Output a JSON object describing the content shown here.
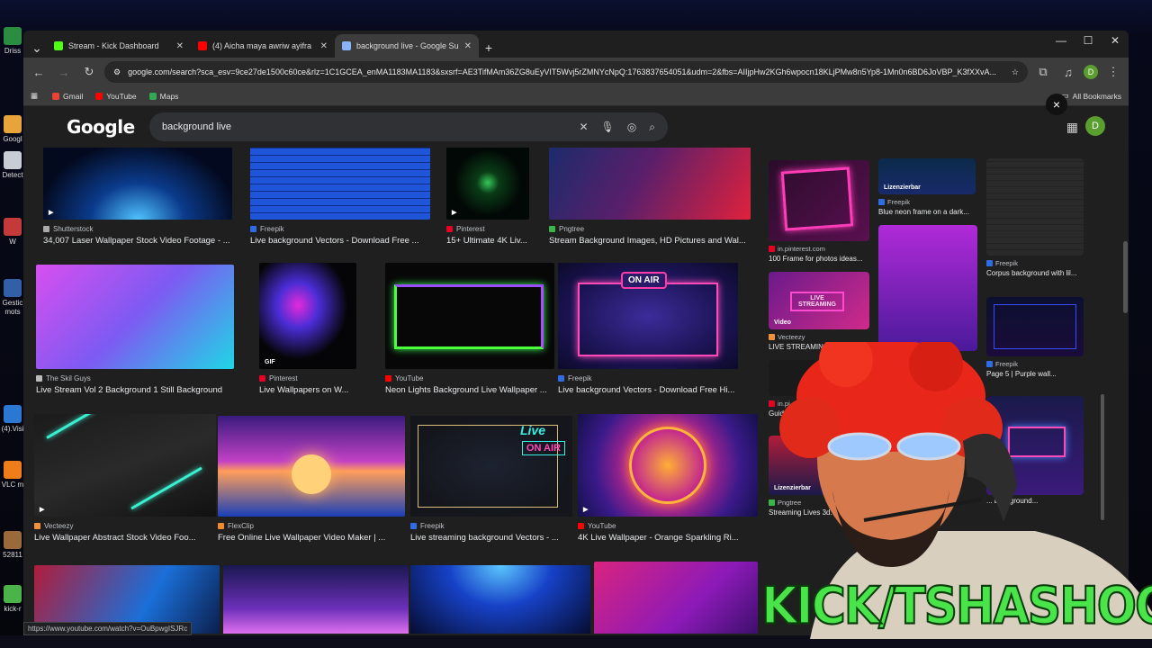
{
  "desktop": {
    "icons": [
      {
        "label": "Driss",
        "color": "#2a8d3f"
      },
      {
        "label": "Googl",
        "color": "#e8a33a"
      },
      {
        "label": "Detect",
        "color": "#c8ccd4"
      },
      {
        "label": "W",
        "color": "#c43a3a"
      },
      {
        "label": "Gestic mots",
        "color": "#335ea8"
      },
      {
        "label": "(4).Visi",
        "color": "#2a78d2"
      },
      {
        "label": "VLC m",
        "color": "#ee7d1a"
      },
      {
        "label": "52811",
        "color": "#9a6a3a"
      },
      {
        "label": "kick-r",
        "color": "#4ab34a"
      }
    ]
  },
  "browser": {
    "tabs": [
      {
        "label": "Stream - Kick Dashboard",
        "favicon_color": "#53fc18",
        "active": false
      },
      {
        "label": "(4) Aicha maya awriw ayifra",
        "favicon_color": "#ff0000",
        "active": false
      },
      {
        "label": "background live - Google Sucha",
        "favicon_color": "#8ab4f8",
        "active": true
      }
    ],
    "new_tab": "+",
    "url": "google.com/search?sca_esv=9ce27de1500c60ce&rlz=1C1GCEA_enMA1183MA1183&sxsrf=AE3TifMAm36ZG8uEyVIT5Wvj5rZMNYcNpQ:1763837654051&udm=2&fbs=AIIjpHw2KGh6wpocn18KLjPMw8n5Yp8-1Mn0n6BD6JoVBP_K3fXXvA...",
    "profile_initial": "D",
    "bookmarks": [
      {
        "label": "Gmail",
        "color": "#ea4335"
      },
      {
        "label": "YouTube",
        "color": "#ff0000"
      },
      {
        "label": "Maps",
        "color": "#34a853"
      }
    ],
    "all_bookmarks": "All Bookmarks",
    "status_url": "https://www.youtube.com/watch?v=OuBpwgISJRc"
  },
  "google": {
    "logo": "Google",
    "query": "background live",
    "profile_initial": "D"
  },
  "results": [
    {
      "source": "Shutterstock",
      "title": "34,007 Laser Wallpaper Stock Video Footage - ...",
      "color": "#aaaaaa",
      "bg": "radial-gradient(ellipse at 50% 100%,#4fc3ff 0,#0b3b8c 35%,#03091e 75%)"
    },
    {
      "source": "Freepik",
      "title": "Live background Vectors - Download Free ...",
      "color": "#2f6be2",
      "bg": "repeating-linear-gradient(0deg,#1f55d8 0 7px,#0f2f90 7px 8px),#1f55d8"
    },
    {
      "source": "Pinterest",
      "title": "15+ Ultimate 4K Liv...",
      "color": "#e60023",
      "bg": "radial-gradient(circle at 50% 50%,#35c75a 0,#0a3c16 20%,#020806 60%)"
    },
    {
      "source": "Pngtree",
      "title": "Stream Background Images, HD Pictures and Wal...",
      "color": "#39b54a",
      "bg": "linear-gradient(120deg,#1b2b6b 0,#5a1f6b 45%,#e0213c 100%)"
    },
    {
      "source": "The Skil Guys",
      "title": "Live Stream Vol 2 Background 1 Still Background",
      "color": "#bbbbbb",
      "bg": "linear-gradient(135deg,#d84ff0 0,#7d5af2 50%,#1fd6e6 100%)"
    },
    {
      "source": "Pinterest",
      "title": "Live Wallpapers on W...",
      "color": "#e60023",
      "bg": "radial-gradient(ellipse at 40% 40%,#e42ad8 0,#4a2dd6 25%,#050508 60%)"
    },
    {
      "source": "YouTube",
      "title": "Neon Lights Background Live Wallpaper ...",
      "color": "#ff0000",
      "bg": "#070707"
    },
    {
      "source": "Freepik",
      "title": "Live background Vectors - Download Free Hi...",
      "color": "#2f6be2",
      "bg": "radial-gradient(ellipse at 50% 50%,#3b2c9a 0,#1b1454 60%,#0c0a2a 100%)"
    },
    {
      "source": "Vecteezy",
      "title": "Live Wallpaper Abstract Stock Video Foo...",
      "color": "#f2913a",
      "bg": "linear-gradient(160deg,#1b1b1b 0,#2a2a2a 50%,#111 100%)"
    },
    {
      "source": "FlexClip",
      "title": "Free Online Live Wallpaper Video Maker | ...",
      "color": "#f08a2c",
      "bg": "linear-gradient(180deg,#391b7e 0,#c241c5 45%,#ff9e5a 55%,#1a3fb8 100%)"
    },
    {
      "source": "Freepik",
      "title": "Live streaming background Vectors - ...",
      "color": "#2f6be2",
      "bg": "radial-gradient(ellipse at 50% 50%,#1d2230 0,#14161c 70%)"
    },
    {
      "source": "YouTube",
      "title": "4K Live Wallpaper - Orange Sparkling Ri...",
      "color": "#ff0000",
      "bg": "radial-gradient(circle at 50% 50%,#ffae35 0,#c2268f 35%,#3a1a8a 70%,#14104a 100%)"
    },
    {
      "source": "",
      "title": "",
      "color": "#000",
      "bg": "linear-gradient(120deg,#b01d3a 0,#1a6fd8 60%,#0b1d4a 100%)"
    },
    {
      "source": "",
      "title": "",
      "color": "#000",
      "bg": "linear-gradient(180deg,#1a1850 0,#6a2fb8 60%,#ef79f5 100%)"
    },
    {
      "source": "",
      "title": "",
      "color": "#000",
      "bg": "radial-gradient(ellipse at 50% 0,#5cc7ff 0,#1742c8 40%,#050a2a 100%)"
    },
    {
      "source": "",
      "title": "",
      "color": "#000",
      "bg": "linear-gradient(135deg,#d9237f 0,#8c1ab8 60%,#3a0f6a 100%)"
    }
  ],
  "badges": {
    "gif": "GIF",
    "on_air": "ON AIR",
    "live": "Live",
    "video": "Video",
    "lizenzierbar": "Lizenzierbar"
  },
  "panel": {
    "close": "×",
    "items": [
      {
        "source": "in.pinterest.com",
        "title": "100 Frame for photos ideas...",
        "color": "#e60023"
      },
      {
        "source": "Freepik",
        "title": "Blue neon frame on a dark...",
        "color": "#2f6be2"
      },
      {
        "source": "Freepik",
        "title": "Corpus background with lil...",
        "color": "#2f6be2"
      },
      {
        "source": "Vecteezy",
        "title": "LIVE STREAMING NEON ...",
        "color": "#f2913a"
      },
      {
        "source": "Freepik",
        "title": "Page 5 | Purple wall...",
        "color": "#2f6be2"
      },
      {
        "source": "in.pi...",
        "title": "Guido To...",
        "color": "#e60023"
      },
      {
        "source": "Pngtree",
        "title": "Streaming Lives 3d...",
        "color": "#39b54a"
      },
      {
        "source": "",
        "title": "... background...",
        "color": "#000"
      }
    ],
    "live_streaming_sign": "LIVE STREAMING"
  },
  "overlay": "KICK/TSHASHOO"
}
